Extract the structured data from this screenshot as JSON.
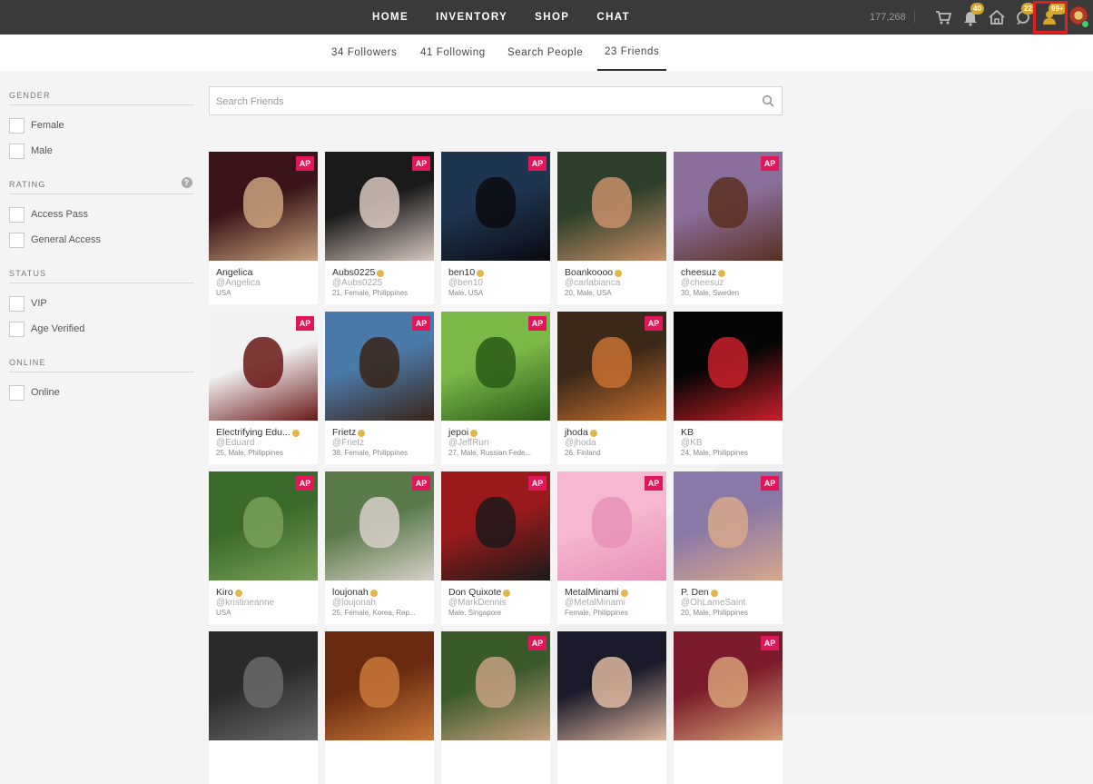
{
  "topnav": {
    "items": [
      "HOME",
      "INVENTORY",
      "SHOP",
      "CHAT"
    ],
    "credits": "177,268",
    "badges": {
      "notifications": "40",
      "messages": "22",
      "friend_requests": "99+"
    }
  },
  "subnav": {
    "followers": "34 Followers",
    "following": "41 Following",
    "search_people": "Search People",
    "friends": "23 Friends"
  },
  "filters": {
    "gender": {
      "title": "GENDER",
      "options": [
        "Female",
        "Male"
      ]
    },
    "rating": {
      "title": "RATING",
      "help": "?",
      "options": [
        "Access Pass",
        "General Access"
      ]
    },
    "status": {
      "title": "STATUS",
      "options": [
        "VIP",
        "Age Verified"
      ]
    },
    "online": {
      "title": "ONLINE",
      "options": [
        "Online"
      ]
    }
  },
  "search": {
    "placeholder": "Search Friends"
  },
  "badge_label": "AP",
  "friends": [
    {
      "name": "Angelica",
      "username": "@Angelica",
      "info": "USA",
      "vip": false,
      "ap": true,
      "colors": [
        "#3a1418",
        "#c9a27e"
      ]
    },
    {
      "name": "Aubs0225",
      "username": "@Aubs0225",
      "info": "21, Female, Philippines",
      "vip": true,
      "ap": true,
      "colors": [
        "#1a1a1a",
        "#d8c8c0"
      ]
    },
    {
      "name": "ben10",
      "username": "@ben10",
      "info": "Male, USA",
      "vip": true,
      "ap": true,
      "colors": [
        "#1e3550",
        "#0a0a10"
      ]
    },
    {
      "name": "Boankoooo",
      "username": "@carlabianca",
      "info": "20, Male, USA",
      "vip": true,
      "ap": false,
      "colors": [
        "#2d3f2a",
        "#c98f6a"
      ]
    },
    {
      "name": "cheesuz",
      "username": "@cheesuz",
      "info": "30, Male, Sweden",
      "vip": true,
      "ap": true,
      "colors": [
        "#8a6e9c",
        "#5a3020"
      ]
    },
    {
      "name": "Electrifying Edu...",
      "username": "@Eduard",
      "info": "25, Male, Philippines",
      "vip": true,
      "ap": true,
      "colors": [
        "#f2f2f2",
        "#6a1818"
      ]
    },
    {
      "name": "Frietz",
      "username": "@Frietz",
      "info": "38, Female, Philippines",
      "vip": true,
      "ap": true,
      "colors": [
        "#4a7aa8",
        "#3a2418"
      ]
    },
    {
      "name": "jepoi",
      "username": "@JeffRun",
      "info": "27, Male, Russian Fede...",
      "vip": true,
      "ap": true,
      "colors": [
        "#7ab848",
        "#2a5a18"
      ]
    },
    {
      "name": "jhoda",
      "username": "@jhoda",
      "info": "26, Finland",
      "vip": true,
      "ap": true,
      "colors": [
        "#3a2818",
        "#c87030"
      ]
    },
    {
      "name": "KB",
      "username": "@KB",
      "info": "24, Male, Philippines",
      "vip": false,
      "ap": false,
      "colors": [
        "#050505",
        "#c8202a"
      ]
    },
    {
      "name": "Kiro",
      "username": "@kristineanne",
      "info": "USA",
      "vip": true,
      "ap": true,
      "colors": [
        "#3a6a2a",
        "#7aa05a"
      ]
    },
    {
      "name": "loujonah",
      "username": "@loujonah",
      "info": "25, Female, Korea, Rep...",
      "vip": true,
      "ap": true,
      "colors": [
        "#5a7a4a",
        "#d8d0c8"
      ]
    },
    {
      "name": "Don Quixote",
      "username": "@MarkDennis",
      "info": "Male, Singapore",
      "vip": true,
      "ap": true,
      "colors": [
        "#9a1a1a",
        "#1a1a1a"
      ]
    },
    {
      "name": "MetalMinami",
      "username": "@MetalMinami",
      "info": "Female, Philippines",
      "vip": true,
      "ap": true,
      "colors": [
        "#f5b8d0",
        "#e890b8"
      ]
    },
    {
      "name": "P. Den",
      "username": "@OhLameSaint",
      "info": "20, Male, Philippines",
      "vip": true,
      "ap": true,
      "colors": [
        "#8a78a8",
        "#d8a88a"
      ]
    },
    {
      "name": "",
      "username": "",
      "info": "",
      "vip": false,
      "ap": false,
      "colors": [
        "#2a2a2a",
        "#6a6a6a"
      ]
    },
    {
      "name": "",
      "username": "",
      "info": "",
      "vip": false,
      "ap": false,
      "colors": [
        "#6a2a10",
        "#c87838"
      ]
    },
    {
      "name": "",
      "username": "",
      "info": "",
      "vip": false,
      "ap": true,
      "colors": [
        "#3a5a2a",
        "#c8a080"
      ]
    },
    {
      "name": "",
      "username": "",
      "info": "",
      "vip": false,
      "ap": false,
      "colors": [
        "#1a1a2a",
        "#e0b8a0"
      ]
    },
    {
      "name": "",
      "username": "",
      "info": "",
      "vip": false,
      "ap": true,
      "colors": [
        "#7a1a2a",
        "#d8a078"
      ]
    }
  ]
}
